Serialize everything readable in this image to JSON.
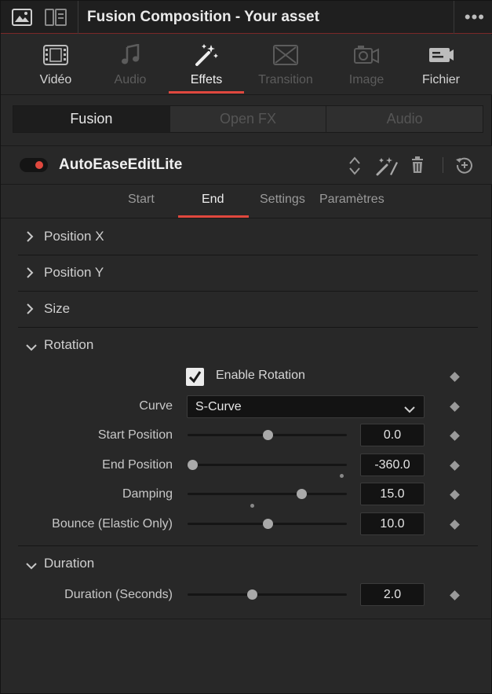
{
  "header": {
    "title": "Fusion Composition - Your asset",
    "more": "•••"
  },
  "categories": [
    {
      "label": "Vidéo",
      "icon": "film-icon",
      "state": "normal"
    },
    {
      "label": "Audio",
      "icon": "music-note-icon",
      "state": "disabled"
    },
    {
      "label": "Effets",
      "icon": "magic-wand-icon",
      "state": "active"
    },
    {
      "label": "Transition",
      "icon": "transition-icon",
      "state": "disabled"
    },
    {
      "label": "Image",
      "icon": "camera-icon",
      "state": "disabled"
    },
    {
      "label": "Fichier",
      "icon": "file-icon",
      "state": "normal"
    }
  ],
  "segments": [
    {
      "label": "Fusion",
      "active": true
    },
    {
      "label": "Open FX",
      "active": false
    },
    {
      "label": "Audio",
      "active": false
    }
  ],
  "effect": {
    "name": "AutoEaseEditLite",
    "enabled": true
  },
  "subtabs": [
    {
      "label": "Start",
      "active": false
    },
    {
      "label": "End",
      "active": true
    },
    {
      "label": "Settings",
      "active": false
    },
    {
      "label": "Paramètres",
      "active": false
    }
  ],
  "sections": {
    "position_x": "Position X",
    "position_y": "Position Y",
    "size": "Size",
    "rotation": "Rotation",
    "duration": "Duration"
  },
  "rotation": {
    "enable_label": "Enable Rotation",
    "enable_checked": true,
    "curve_label": "Curve",
    "curve_value": "S-Curve",
    "start_position": {
      "label": "Start Position",
      "value": "0.0",
      "slider": 0.5
    },
    "end_position": {
      "label": "End Position",
      "value": "-360.0",
      "slider": 0.0
    },
    "damping": {
      "label": "Damping",
      "value": "15.0",
      "slider": 0.73
    },
    "bounce": {
      "label": "Bounce (Elastic Only)",
      "value": "10.0",
      "slider": 0.5
    }
  },
  "duration": {
    "seconds": {
      "label": "Duration (Seconds)",
      "value": "2.0",
      "slider": 0.4
    }
  },
  "colors": {
    "accent": "#e0483e",
    "background": "#282828",
    "field": "#131313"
  }
}
